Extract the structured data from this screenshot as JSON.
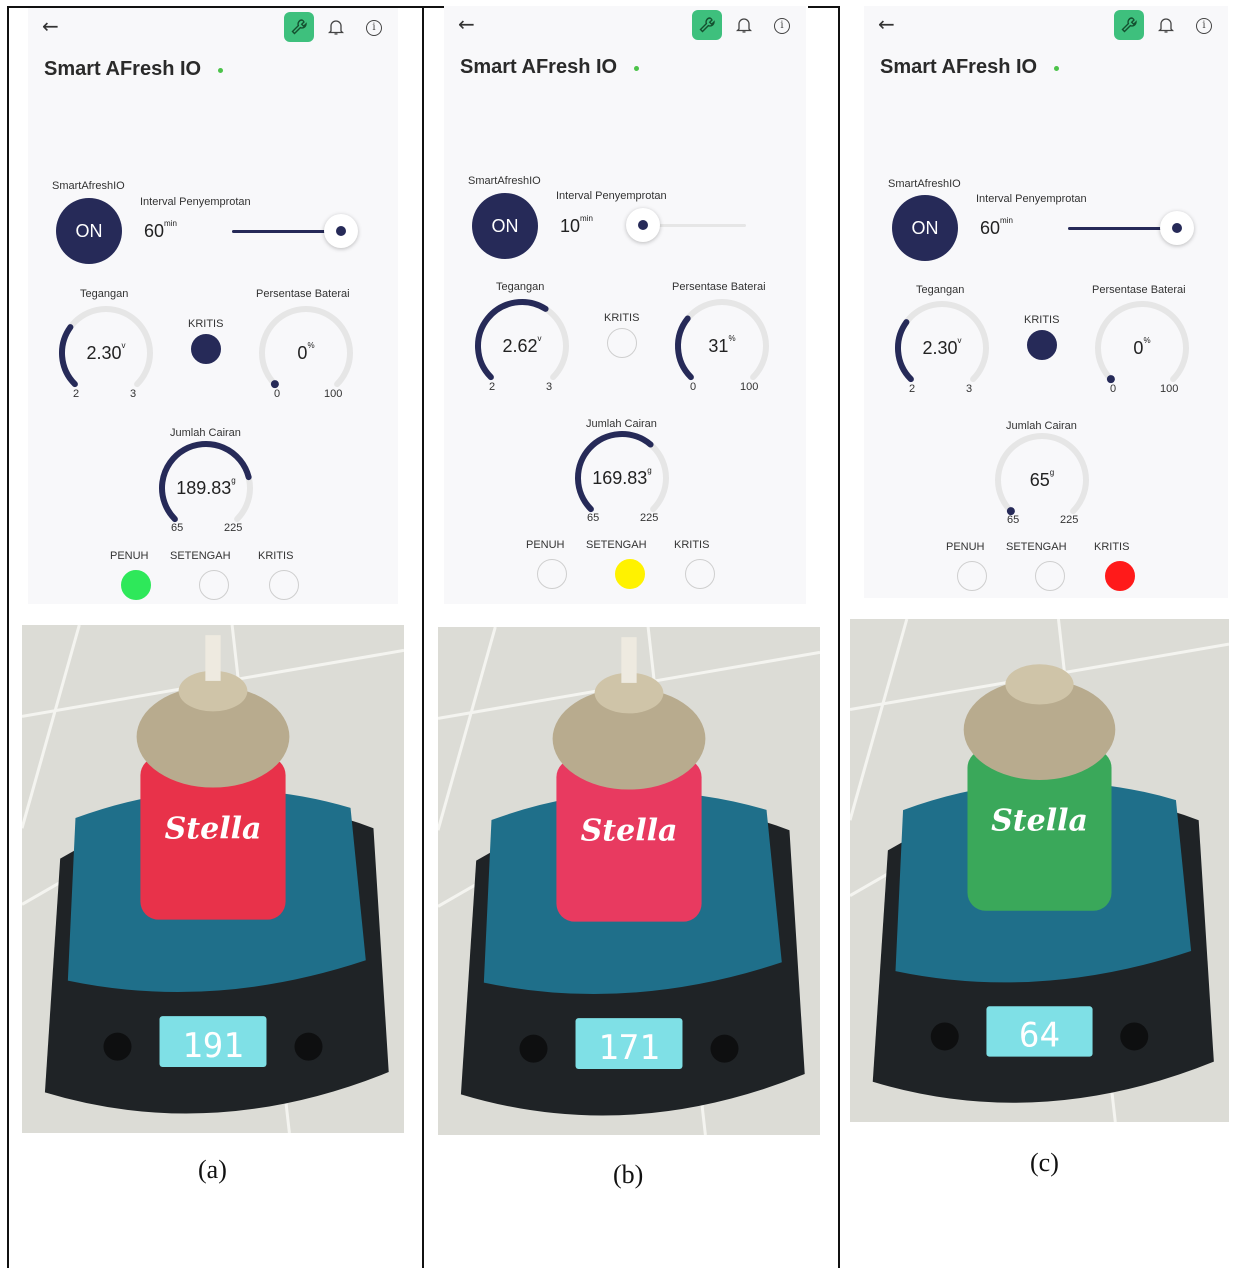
{
  "colors": {
    "navy": "#262a58",
    "green_on": "#3ec07d",
    "full": "#2ee85a",
    "half": "#fff200",
    "critical": "#ff1a1a",
    "track": "#e6e6e6"
  },
  "panels": [
    {
      "caption": "(a)",
      "app_title": "Smart AFresh IO",
      "device_label": "SmartAfreshIO",
      "on_label": "ON",
      "interval_label": "Interval Penyemprotan",
      "interval_value": "60",
      "interval_unit": "min",
      "interval_fraction": 1.0,
      "voltage": {
        "label": "Tegangan",
        "value": "2.30",
        "unit": "v",
        "min": "2",
        "max": "3",
        "fraction": 0.3
      },
      "kritis_label": "KRITIS",
      "kritis_active": true,
      "battery": {
        "label": "Persentase Baterai",
        "value": "0",
        "unit": "%",
        "min": "0",
        "max": "100",
        "fraction": 0.0
      },
      "liquid": {
        "label": "Jumlah Cairan",
        "value": "189.83",
        "unit": "g",
        "min": "65",
        "max": "225",
        "fraction": 0.78
      },
      "status_labels": [
        "PENUH",
        "SETENGAH",
        "KRITIS"
      ],
      "status_active": "PENUH",
      "scale_reading": "191",
      "can_color": "#e8324a",
      "can_text": "Stella"
    },
    {
      "caption": "(b)",
      "app_title": "Smart AFresh IO",
      "device_label": "SmartAfreshIO",
      "on_label": "ON",
      "interval_label": "Interval Penyemprotan",
      "interval_value": "10",
      "interval_unit": "min",
      "interval_fraction": 0.0,
      "voltage": {
        "label": "Tegangan",
        "value": "2.62",
        "unit": "v",
        "min": "2",
        "max": "3",
        "fraction": 0.62
      },
      "kritis_label": "KRITIS",
      "kritis_active": false,
      "battery": {
        "label": "Persentase Baterai",
        "value": "31",
        "unit": "%",
        "min": "0",
        "max": "100",
        "fraction": 0.31
      },
      "liquid": {
        "label": "Jumlah Cairan",
        "value": "169.83",
        "unit": "g",
        "min": "65",
        "max": "225",
        "fraction": 0.65
      },
      "status_labels": [
        "PENUH",
        "SETENGAH",
        "KRITIS"
      ],
      "status_active": "SETENGAH",
      "scale_reading": "171",
      "can_color": "#e83a60",
      "can_text": "Stella"
    },
    {
      "caption": "(c)",
      "app_title": "Smart AFresh IO",
      "device_label": "SmartAfreshIO",
      "on_label": "ON",
      "interval_label": "Interval Penyemprotan",
      "interval_value": "60",
      "interval_unit": "min",
      "interval_fraction": 1.0,
      "voltage": {
        "label": "Tegangan",
        "value": "2.30",
        "unit": "v",
        "min": "2",
        "max": "3",
        "fraction": 0.3
      },
      "kritis_label": "KRITIS",
      "kritis_active": true,
      "battery": {
        "label": "Persentase Baterai",
        "value": "0",
        "unit": "%",
        "min": "0",
        "max": "100",
        "fraction": 0.0
      },
      "liquid": {
        "label": "Jumlah Cairan",
        "value": "65",
        "unit": "g",
        "min": "65",
        "max": "225",
        "fraction": 0.0
      },
      "status_labels": [
        "PENUH",
        "SETENGAH",
        "KRITIS"
      ],
      "status_active": "KRITIS",
      "scale_reading": "64",
      "can_color": "#3aa85a",
      "can_text": "Stella"
    }
  ]
}
